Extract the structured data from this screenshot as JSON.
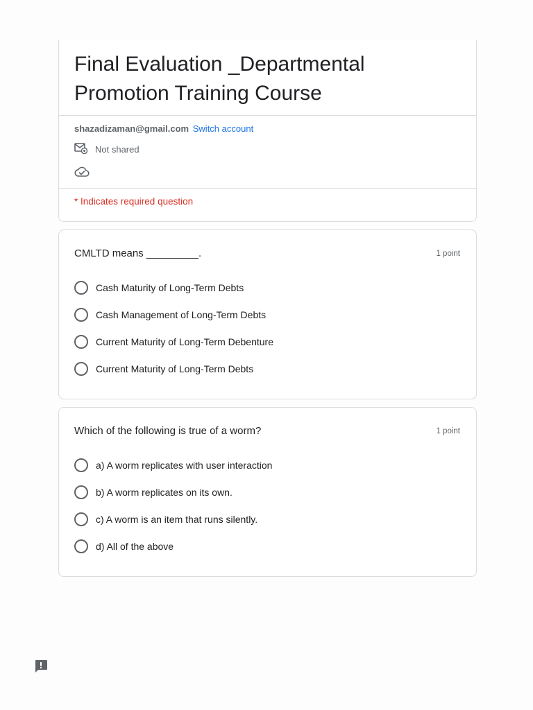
{
  "form": {
    "title": "Final Evaluation _Departmental Promotion Training Course",
    "account_email": "shazadizaman@gmail.com",
    "switch_account": "Switch account",
    "not_shared": "Not shared",
    "required_note": "* Indicates required question"
  },
  "questions": [
    {
      "title": "CMLTD means _________.",
      "points": "1 point",
      "options": [
        "Cash Maturity of Long-Term Debts",
        "Cash Management of Long-Term Debts",
        "Current Maturity of Long-Term Debenture",
        "Current Maturity of Long-Term Debts"
      ]
    },
    {
      "title": "Which of the following is true of a worm?",
      "points": "1 point",
      "options": [
        "a) A worm replicates with user interaction",
        "b) A worm replicates on its own.",
        "c) A worm is an item that runs silently.",
        "d) All of the above"
      ]
    }
  ],
  "icons": {
    "mail": "mail-settings-icon",
    "cloud": "cloud-saved-icon",
    "feedback": "feedback-icon"
  },
  "colors": {
    "link": "#1a73e8",
    "required": "#d93025",
    "border": "#dadce0"
  }
}
